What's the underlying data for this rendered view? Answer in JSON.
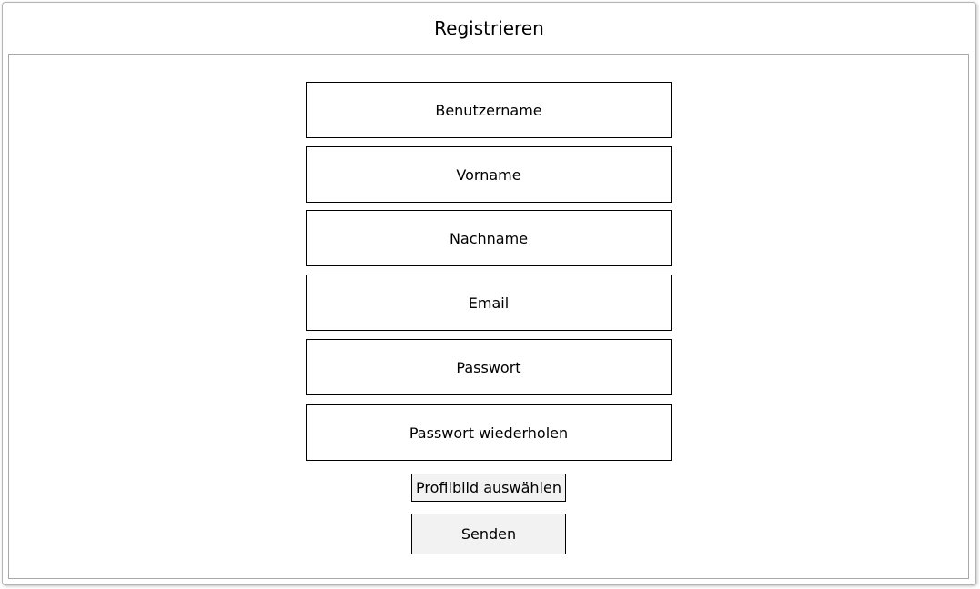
{
  "window": {
    "title": "Registrieren"
  },
  "form": {
    "fields": [
      {
        "label": "Benutzername"
      },
      {
        "label": "Vorname"
      },
      {
        "label": "Nachname"
      },
      {
        "label": "Email"
      },
      {
        "label": "Passwort"
      },
      {
        "label": "Passwort wiederholen"
      }
    ],
    "profile_button_label": "Profilbild auswählen",
    "submit_button_label": "Senden"
  }
}
